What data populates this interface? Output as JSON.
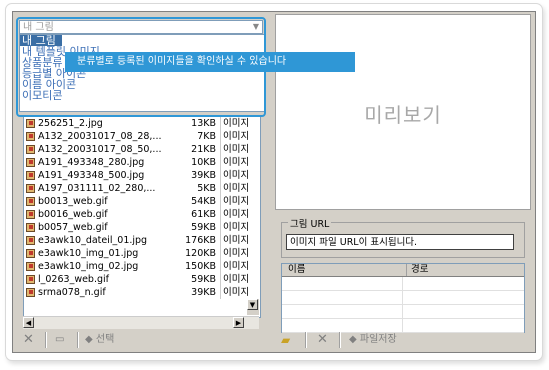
{
  "category_select": {
    "value": "내 그림",
    "options": [
      "내 그림",
      "내 템플릿 이미지",
      "상품분류 아이콘",
      "등급별 아이콘",
      "이름 아이콘",
      "이모티콘"
    ]
  },
  "tooltip": "분류별로 등록된 이미지들을 확인하실 수 있습니다",
  "files": [
    {
      "name": "256251_2.jpg",
      "size": "13KB",
      "type": "이미지"
    },
    {
      "name": "A132_20031017_08_28,...",
      "size": "7KB",
      "type": "이미지"
    },
    {
      "name": "A132_20031017_08_50,...",
      "size": "21KB",
      "type": "이미지"
    },
    {
      "name": "A191_493348_280.jpg",
      "size": "10KB",
      "type": "이미지"
    },
    {
      "name": "A191_493348_500.jpg",
      "size": "39KB",
      "type": "이미지"
    },
    {
      "name": "A197_031111_02_280,...",
      "size": "5KB",
      "type": "이미지"
    },
    {
      "name": "b0013_web.gif",
      "size": "54KB",
      "type": "이미지"
    },
    {
      "name": "b0016_web.gif",
      "size": "61KB",
      "type": "이미지"
    },
    {
      "name": "b0057_web.gif",
      "size": "59KB",
      "type": "이미지"
    },
    {
      "name": "e3awk10_dateil_01.jpg",
      "size": "176KB",
      "type": "이미지"
    },
    {
      "name": "e3awk10_img_01.jpg",
      "size": "120KB",
      "type": "이미지"
    },
    {
      "name": "e3awk10_img_02.jpg",
      "size": "150KB",
      "type": "이미지"
    },
    {
      "name": "l_0263_web.gif",
      "size": "59KB",
      "type": "이미지"
    },
    {
      "name": "srma078_n.gif",
      "size": "39KB",
      "type": "이미지"
    }
  ],
  "left_toolbar": {
    "delete_icon": "x-icon",
    "view_icon": "monitor-icon",
    "select_label": "선택"
  },
  "preview": {
    "label": "미리보기"
  },
  "url_group": {
    "title": "그림 URL",
    "value": "이미지 파일 URL이 표시됩니다."
  },
  "table": {
    "headers": [
      "이름",
      "경로"
    ]
  },
  "right_toolbar": {
    "folder_icon": "folder-icon",
    "delete_icon": "x-icon",
    "save_label": "파일저장"
  },
  "colors": {
    "accent": "#2f97d6",
    "selection": "#3a6ea5",
    "panel": "#d4d0c8"
  }
}
